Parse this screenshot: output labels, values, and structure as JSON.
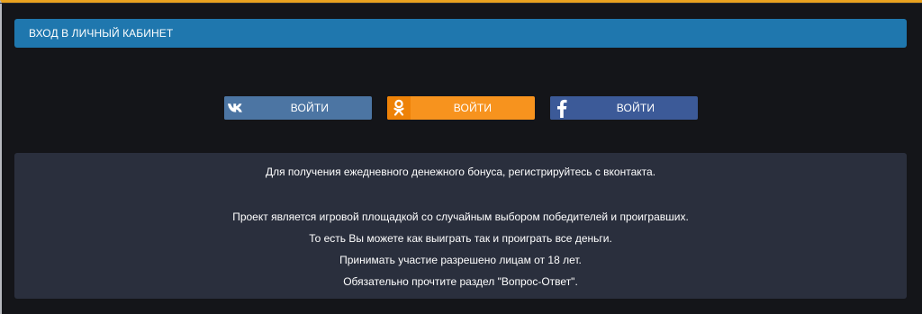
{
  "header": {
    "title": "ВХОД В ЛИЧНЫЙ КАБИНЕТ"
  },
  "login_buttons": [
    {
      "network": "vk",
      "icon": "vk-icon",
      "label": "ВОЙТИ",
      "color": "#4C75A3"
    },
    {
      "network": "ok",
      "icon": "odnoklassniki-icon",
      "label": "ВОЙТИ",
      "color": "#F7931E"
    },
    {
      "network": "fb",
      "icon": "facebook-icon",
      "label": "ВОЙТИ",
      "color": "#3C5A98"
    }
  ],
  "info": {
    "bonus_text": "Для получения ежедневного денежного бонуса, регистрируйтесь с вконтакта.",
    "lines": [
      "Проект является игровой площадкой со случайным выбором победителей и проигравших.",
      "То есть Вы можете как выиграть так и проиграть все деньги.",
      "Принимать участие разрешено лицам от 18 лет.",
      "Обязательно прочтите раздел \"Вопрос-Ответ\"."
    ]
  },
  "colors": {
    "background": "#141519",
    "top_accent": "#E9A21F",
    "header_bg": "#1F77AE",
    "info_bg": "#2A2F3D"
  }
}
